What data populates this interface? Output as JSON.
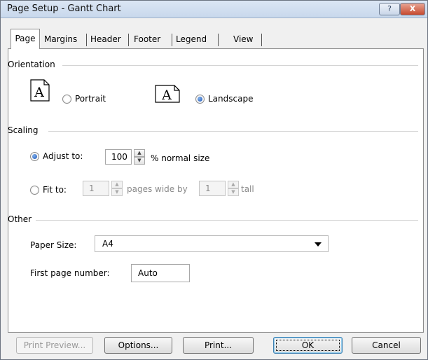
{
  "window": {
    "title": "Page Setup - Gantt Chart",
    "help_glyph": "?",
    "close_glyph": "X"
  },
  "tabs": [
    {
      "label": "Page",
      "active": true
    },
    {
      "label": "Margins",
      "active": false
    },
    {
      "label": "Header",
      "active": false
    },
    {
      "label": "Footer",
      "active": false
    },
    {
      "label": "Legend",
      "active": false
    },
    {
      "label": "View",
      "active": false
    }
  ],
  "orientation": {
    "section_label": "Orientation",
    "portrait_label": "Portrait",
    "landscape_label": "Landscape",
    "selected": "landscape",
    "icon_letter": "A"
  },
  "scaling": {
    "section_label": "Scaling",
    "adjust_to_label": "Adjust to:",
    "adjust_value": "100",
    "normal_size_label": "% normal size",
    "fit_to_label": "Fit to:",
    "pages_wide_value": "1",
    "pages_wide_label": "pages wide by",
    "tall_value": "1",
    "tall_label": "tall",
    "selected": "adjust"
  },
  "other": {
    "section_label": "Other",
    "paper_size_label": "Paper Size:",
    "paper_size_value": "A4",
    "first_page_label": "First page number:",
    "first_page_value": "Auto"
  },
  "buttons": {
    "print_preview": "Print Preview...",
    "options": "Options...",
    "print": "Print...",
    "ok": "OK",
    "cancel": "Cancel"
  },
  "colors": {
    "accent": "#1e55b8",
    "disabled_text": "#8a8a8a"
  }
}
